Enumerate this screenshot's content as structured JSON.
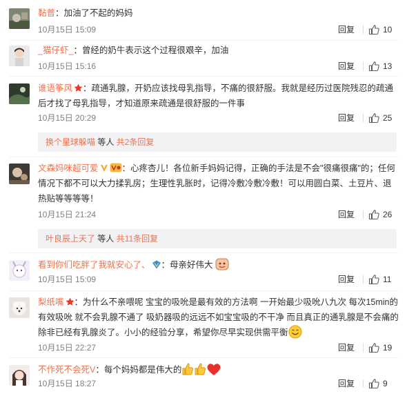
{
  "reply_label": "回复",
  "comments": [
    {
      "user": "黏普",
      "text": "加油了不起的妈妈",
      "time": "10月15日 15:09",
      "likes": "10"
    },
    {
      "user": "_猫仔虾_",
      "text": "曾经的奶牛表示这个过程很艰辛，加油",
      "time": "10月15日 15:16",
      "likes": "13"
    },
    {
      "user": "谁语筝风",
      "text": "疏通乳腺，开奶应该找母乳指导，不痛的很舒服。我就是经历过医院残忍的疏通后才找了母乳指导，才知道原来疏通是很舒服的一件事",
      "time": "10月15日 20:29",
      "likes": "25",
      "sub": {
        "who": "换个星球躲喵",
        "mid": " 等人 ",
        "total": "共2条回复"
      }
    },
    {
      "user": "文森妈咪超可爱",
      "text": "心疼杏儿！各位新手妈妈记得，正确的手法是不会\"很痛很痛\"的；任何情况下都不可以大力揉乳房；生理性乳胀时，记得冷敷冷敷冷敷！可以用圆白菜、土豆片、退热贴等等等等！",
      "time": "10月15日 21:24",
      "likes": "26",
      "sub": {
        "who": "叶良辰上天了",
        "mid": " 等人 ",
        "total": "共11条回复"
      }
    },
    {
      "user": "看到你们吃胖了我就安心了、",
      "text": "母亲好伟大",
      "time": "10月15日 15:09",
      "likes": "11"
    },
    {
      "user": "梨纸嘴",
      "text": "为什么不亲喂呢 宝宝的吸吮是最有效的方法啊 一开始最少吸吮八九次 每次15min的有效吸吮 就不会乳腺不通了 吸奶器吸的远远不如宝宝吸的不干净 而且真正的通乳腺是不会痛的 除非已经有乳腺炎了。小小的经验分享，希望你尽早实现供需平衡",
      "time": "10月15日 22:27",
      "likes": "19"
    },
    {
      "user": "不作死不会死V",
      "text": "每个妈妈都是伟大的",
      "time": "10月15日 18:27",
      "likes": "9"
    }
  ],
  "colors": {
    "username": "#eb7350",
    "text": "#333333",
    "meta": "#808080",
    "subbox_bg": "#f2f2f5"
  }
}
